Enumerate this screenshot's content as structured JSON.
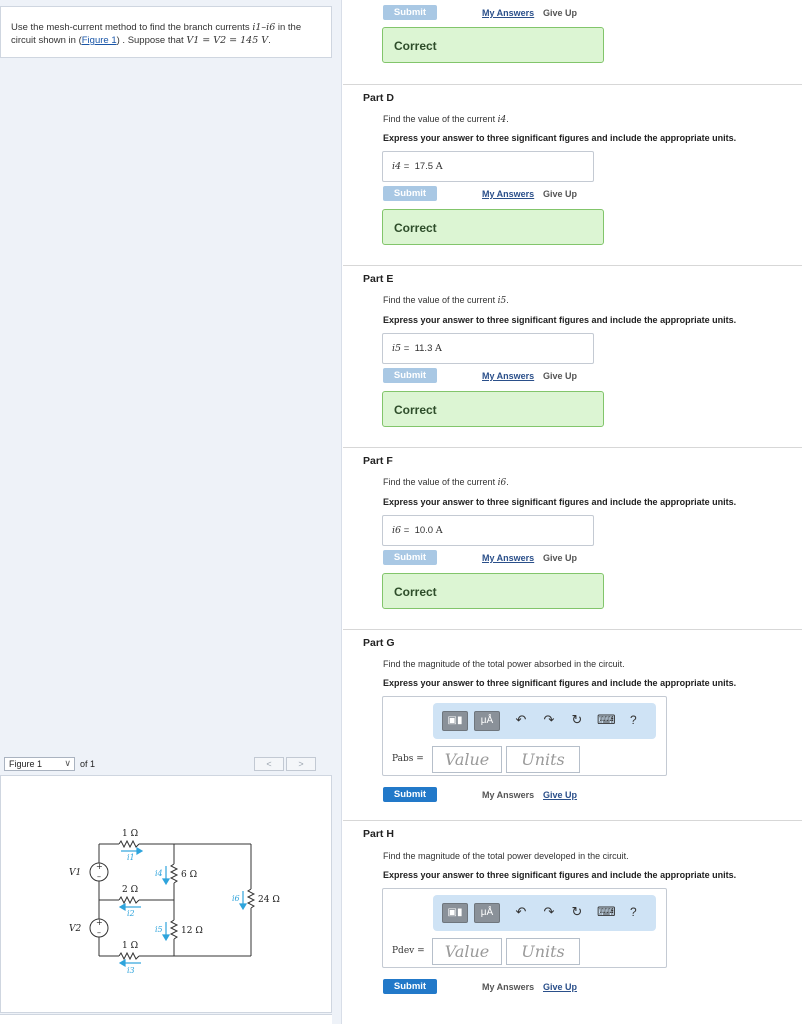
{
  "problem": {
    "text_before": "Use the mesh-current method to find the branch currents ",
    "currents": "i1–i6",
    "text_middle": " in the circuit shown in (",
    "figure_link": "Figure 1",
    "text_after": ") . Suppose that ",
    "equation": "V1 = V2 = 145 V",
    "end": "."
  },
  "figure_nav": {
    "selected": "Figure 1",
    "of_label": "of 1",
    "prev": "<",
    "next": ">"
  },
  "circuit": {
    "v1": "V1",
    "v2": "V2",
    "r_top": "1 Ω",
    "r_mid": "2 Ω",
    "r_bot": "1 Ω",
    "r_6": "6 Ω",
    "r_12": "12 Ω",
    "r_24": "24 Ω",
    "i1": "i1",
    "i2": "i2",
    "i3": "i3",
    "i4": "i4",
    "i5": "i5",
    "i6": "i6"
  },
  "labels": {
    "submit": "Submit",
    "my_answers": "My Answers",
    "give_up": "Give Up",
    "correct": "Correct",
    "instruction": "Express your answer to three significant figures and include the appropriate units.",
    "value_placeholder": "Value",
    "units_placeholder": "Units"
  },
  "parts": {
    "d": {
      "title": "Part D",
      "question": "Find the value of the current ",
      "var": "i4",
      "answer_var": "i4",
      "answer_value": "17.5",
      "answer_unit": "A"
    },
    "e": {
      "title": "Part E",
      "question": "Find the value of the current ",
      "var": "i5",
      "answer_var": "i5",
      "answer_value": "11.3",
      "answer_unit": "A"
    },
    "f": {
      "title": "Part F",
      "question": "Find the value of the current ",
      "var": "i6",
      "answer_var": "i6",
      "answer_value": "10.0",
      "answer_unit": "A"
    },
    "g": {
      "title": "Part G",
      "question": "Find the magnitude of the total power absorbed in the circuit.",
      "label": "Pabs ="
    },
    "h": {
      "title": "Part H",
      "question": "Find the magnitude of the total power developed in the circuit.",
      "label": "Pdev ="
    }
  },
  "toolbar": {
    "templates_icon": "templates-icon",
    "units_icon_label": "μÅ",
    "undo_icon": "undo-icon",
    "redo_icon": "redo-icon",
    "reset_icon": "reset-icon",
    "keyboard_icon": "keyboard-icon",
    "help": "?"
  },
  "colors": {
    "submit_active": "#2279c9",
    "submit_disabled": "#a9c8e4",
    "correct_bg": "#dcf5d3",
    "correct_border": "#82c56b",
    "toolbar_bg": "#cfe3f5",
    "current_arrow": "#2fa4dc"
  }
}
